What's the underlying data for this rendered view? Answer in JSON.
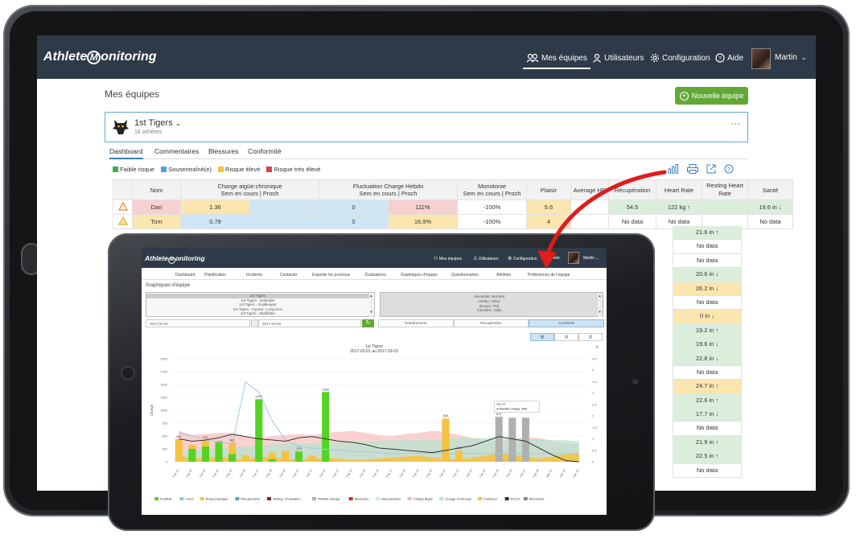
{
  "back": {
    "logo_pre": "Athlete",
    "logo_m": "M",
    "logo_post": "onitoring",
    "nav": {
      "teams": "Mes équipes",
      "users": "Utilisateurs",
      "config": "Configuration",
      "help": "Aide",
      "user": "Martin"
    },
    "page_title": "Mes équipes",
    "new_team": "Nouvelle équipe",
    "team_name": "1st Tigers",
    "team_athletes": "18 athlètes",
    "more": "···",
    "tabs": [
      "Dashboard",
      "Commentaires",
      "Blessures",
      "Conformité"
    ],
    "legend": [
      {
        "label": "Faible risque",
        "color": "#3fae49"
      },
      {
        "label": "Sousentraîné(e)",
        "color": "#4aa3df"
      },
      {
        "label": "Risque élevé",
        "color": "#f5c242"
      },
      {
        "label": "Risque très élevé",
        "color": "#e04040"
      }
    ],
    "columns": {
      "nom": "Nom",
      "acute": "Charge aigüe:chronique",
      "acute_sub": "Sem en cours | Proch",
      "fluct": "Fluctuation Charge Hebdo",
      "fluct_sub": "Sem en cours | Proch",
      "mono": "Monotonie",
      "mono_sub": "Sem en cours | Proch",
      "plaisir": "Plaisir",
      "avg_hr": "Average HR",
      "recup": "Récupération",
      "heart_rate": "Heart Rate",
      "resting": "Resting Heart Rate",
      "sante": "Santé"
    },
    "rows": [
      {
        "name": "Dan",
        "ac": "1.36",
        "ac2": "",
        "fl": "0",
        "fl2": "111%",
        "mono": "-100%",
        "plaisir": "5.6",
        "hr": "",
        "recup": "54.5",
        "heart": "122 kg ↑",
        "rest": "",
        "sante": "19.6 in ↓"
      },
      {
        "name": "Tom",
        "ac": "0.79",
        "ac2": "",
        "fl": "0",
        "fl2": "16.9%",
        "mono": "-100%",
        "plaisir": "4",
        "hr": "",
        "recup": "No data",
        "heart": "No data",
        "rest": "",
        "sante": "No data"
      }
    ],
    "sante_column": [
      "21.6 in ↑",
      "No data",
      "No data",
      "20.6 in ↓",
      "26.2 in ↓",
      "No data",
      "0 in ↓",
      "19.2 in ↑",
      "19.6 in ↓",
      "22.8 in ↓",
      "No data",
      "24.7 in ↑",
      "22.6 in ↑",
      "17.7 in ↓",
      "No data",
      "21.9 in ↑",
      "22.5 in ↑",
      "No data"
    ]
  },
  "front": {
    "nav": {
      "teams": "Mes équipes",
      "users": "Utilisateurs",
      "config": "Configuration",
      "help": "Aide",
      "user": "Martin"
    },
    "tabs": [
      "Dashboard",
      "Planification",
      "Incidents",
      "Contacter",
      "Exporter les journaux",
      "Évaluations",
      "Graphiques d'équipe",
      "Questionnaires",
      "Athlètes",
      "Préférences de l'équipe"
    ],
    "section_title": "Graphiques d'équipe",
    "team_list": [
      "1st Tigers",
      "1st Tigers - Defender",
      "1st Tigers - Goalkeeper",
      "1st Tigers - Injured - Long term",
      "1st Tigers - Midfielder"
    ],
    "athlete_list": [
      "Alexander, Bernard",
      "Ashley, Arthur",
      "Brower, Phil",
      "Cassidee, Sally"
    ],
    "date_from": "2017-02-01",
    "date_to": "2017-03-03",
    "segments": [
      "Entraînement",
      "Récupération",
      "Combinés"
    ],
    "chart_title": "1st Tigers",
    "chart_subtitle": "2017-02-01 au 2017-03-03",
    "y_label": "Charge",
    "tooltip_title": "Sep 24",
    "tooltip_line": "● Planifié Charge: 855",
    "legend": [
      {
        "label": "Football",
        "color": "#55d322"
      },
      {
        "label": "Force",
        "color": "#8ec9ea"
      },
      {
        "label": "Prépa physique",
        "color": "#f5c242"
      },
      {
        "label": "Récupération",
        "color": "#4aa3df"
      },
      {
        "label": "Testing / Évaluation",
        "color": "#8b1a1a"
      },
      {
        "label": "Planifié Charge",
        "color": "#b0b0b0"
      },
      {
        "label": "Blessures",
        "color": "#e02020"
      },
      {
        "label": "Récupération",
        "color": "#cfe6f3"
      },
      {
        "label": "Charge Aigüe",
        "color": "#f7b8b8"
      },
      {
        "label": "Charge Chronique",
        "color": "#b7e4cf"
      },
      {
        "label": "Fraîcheur",
        "color": "#f5c242"
      },
      {
        "label": "RCCA",
        "color": "#333333"
      },
      {
        "label": "Monotonie",
        "color": "#888888"
      }
    ]
  },
  "chart_data": {
    "type": "bar",
    "title": "1st Tigers",
    "subtitle": "2017-02-01 au 2017-03-03",
    "ylabel": "Charge",
    "ylim": [
      0,
      2000
    ],
    "y2lim": [
      0,
      4.5
    ],
    "y_ticks": [
      0,
      250,
      500,
      750,
      1000,
      1250,
      1500,
      1750,
      2000
    ],
    "y2_ticks": [
      0,
      0.5,
      1,
      1.5,
      2,
      2.5,
      3,
      3.5,
      4,
      4.5
    ],
    "categories": [
      "Feb 01",
      "Feb 02",
      "Feb 03",
      "Feb 04",
      "Feb 05",
      "Feb 06",
      "Feb 07",
      "Feb 08",
      "Feb 09",
      "Feb 10",
      "Feb 11",
      "Feb 12",
      "Feb 13",
      "Feb 14",
      "Feb 15",
      "Feb 16",
      "Feb 17",
      "Feb 18",
      "Feb 19",
      "Feb 20",
      "Feb 21",
      "Feb 22",
      "Feb 23",
      "Feb 24",
      "Feb 25",
      "Feb 26",
      "Feb 27",
      "Feb 28",
      "Mar 01",
      "Mar 02",
      "Mar 03"
    ],
    "series": [
      {
        "name": "Football",
        "values": [
          0,
          250,
          300,
          400,
          150,
          0,
          1215,
          50,
          0,
          200,
          0,
          1355,
          0,
          0,
          0,
          0,
          0,
          0,
          0,
          0,
          0,
          0,
          0,
          0,
          0,
          0,
          0,
          0,
          0,
          0,
          0
        ]
      },
      {
        "name": "Prépa physique",
        "values": [
          440,
          80,
          120,
          0,
          220,
          130,
          0,
          130,
          210,
          0,
          120,
          0,
          0,
          0,
          0,
          0,
          0,
          0,
          0,
          0,
          840,
          218,
          0,
          0,
          0,
          0,
          0,
          0,
          0,
          0,
          0
        ]
      },
      {
        "name": "Planifié Charge",
        "values": [
          0,
          0,
          0,
          0,
          0,
          0,
          0,
          0,
          0,
          0,
          0,
          0,
          0,
          0,
          0,
          0,
          0,
          0,
          0,
          0,
          0,
          0,
          0,
          0,
          873,
          855,
          855,
          0,
          0,
          0,
          0
        ]
      }
    ],
    "data_labels": [
      "440",
      "",
      "422",
      "",
      "582",
      "",
      "1215",
      "",
      "",
      "379",
      "",
      "1355",
      "",
      "",
      "",
      "",
      "",
      "",
      "",
      "",
      "840",
      "218",
      "",
      "",
      "873",
      "",
      "",
      "",
      "",
      "",
      ""
    ]
  }
}
